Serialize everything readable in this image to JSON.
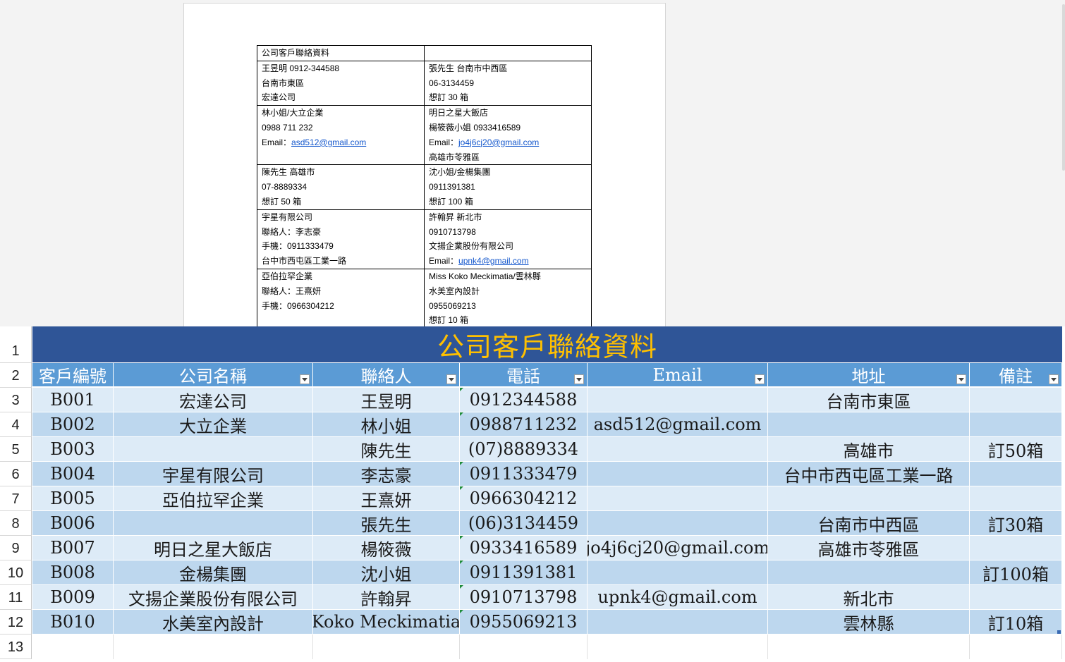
{
  "document": {
    "table": [
      [
        [
          "公司客戶聯絡資料"
        ],
        [
          ""
        ]
      ],
      [
        [
          "王昱明  0912-344588",
          "台南市東區",
          "宏達公司"
        ],
        [
          "張先生  台南市中西區",
          "06-3134459",
          "想訂 30 箱"
        ]
      ],
      [
        [
          "林小姐/大立企業",
          "0988 711 232",
          {
            "prefix": "Email：",
            "link": "asd512@gmail.com"
          }
        ],
        [
          "明日之星大飯店",
          "楊筱薇小姐  0933416589",
          {
            "prefix": "Email：",
            "link": "jo4j6cj20@gmail.com"
          },
          "高雄市苓雅區"
        ]
      ],
      [
        [
          "陳先生  高雄市",
          "07-8889334",
          "想訂 50 箱"
        ],
        [
          "沈小姐/金楊集團",
          "0911391381",
          "想訂 100 箱"
        ]
      ],
      [
        [
          "宇星有限公司",
          "聯絡人：李志豪",
          "手機：0911333479",
          "台中市西屯區工業一路"
        ],
        [
          "許翰昇  新北市",
          "0910713798",
          "文揚企業股份有限公司",
          {
            "prefix": "Email：",
            "link": "upnk4@gmail.com"
          }
        ]
      ],
      [
        [
          "亞伯拉罕企業",
          "聯絡人：王熹妍",
          "手機：0966304212"
        ],
        [
          "Miss Koko Meckimatia/雲林縣",
          "水美室內設計",
          "0955069213",
          "想訂 10 箱"
        ]
      ]
    ]
  },
  "sheet": {
    "row_numbers": [
      "1",
      "2",
      "3",
      "4",
      "5",
      "6",
      "7",
      "8",
      "9",
      "10",
      "11",
      "12",
      "13"
    ],
    "title": "公司客戶聯絡資料",
    "headers": [
      "客戶編號",
      "公司名稱",
      "聯絡人",
      "電話",
      "Email",
      "地址",
      "備註"
    ],
    "rows": [
      [
        "B001",
        "宏達公司",
        "王昱明",
        "0912344588",
        "",
        "台南市東區",
        ""
      ],
      [
        "B002",
        "大立企業",
        "林小姐",
        "0988711232",
        "asd512@gmail.com",
        "",
        ""
      ],
      [
        "B003",
        "",
        "陳先生",
        "(07)8889334",
        "",
        "高雄市",
        "訂50箱"
      ],
      [
        "B004",
        "宇星有限公司",
        "李志豪",
        "0911333479",
        "",
        "台中市西屯區工業一路",
        ""
      ],
      [
        "B005",
        "亞伯拉罕企業",
        "王熹妍",
        "0966304212",
        "",
        "",
        ""
      ],
      [
        "B006",
        "",
        "張先生",
        "(06)3134459",
        "",
        "台南市中西區",
        "訂30箱"
      ],
      [
        "B007",
        "明日之星大飯店",
        "楊筱薇",
        "0933416589",
        "jo4j6cj20@gmail.com",
        "高雄市苓雅區",
        ""
      ],
      [
        "B008",
        "金楊集團",
        "沈小姐",
        "0911391381",
        "",
        "",
        "訂100箱"
      ],
      [
        "B009",
        "文揚企業股份有限公司",
        "許翰昇",
        "0910713798",
        "upnk4@gmail.com",
        "新北市",
        ""
      ],
      [
        "B010",
        "水美室內設計",
        "Koko Meckimatia",
        "0955069213",
        "",
        "雲林縣",
        "訂10箱"
      ]
    ],
    "text_number_rows": [
      0,
      1,
      3,
      4,
      6,
      7,
      8,
      9
    ],
    "colors": {
      "title_bg": "#2f5597",
      "title_fg": "#ffc000",
      "header_bg": "#5b9bd5",
      "band_light": "#ddebf7",
      "band_dark": "#bdd7ee"
    },
    "icons": {
      "filter": "filter-dropdown-icon",
      "error_indicator": "number-as-text-indicator-icon"
    }
  }
}
